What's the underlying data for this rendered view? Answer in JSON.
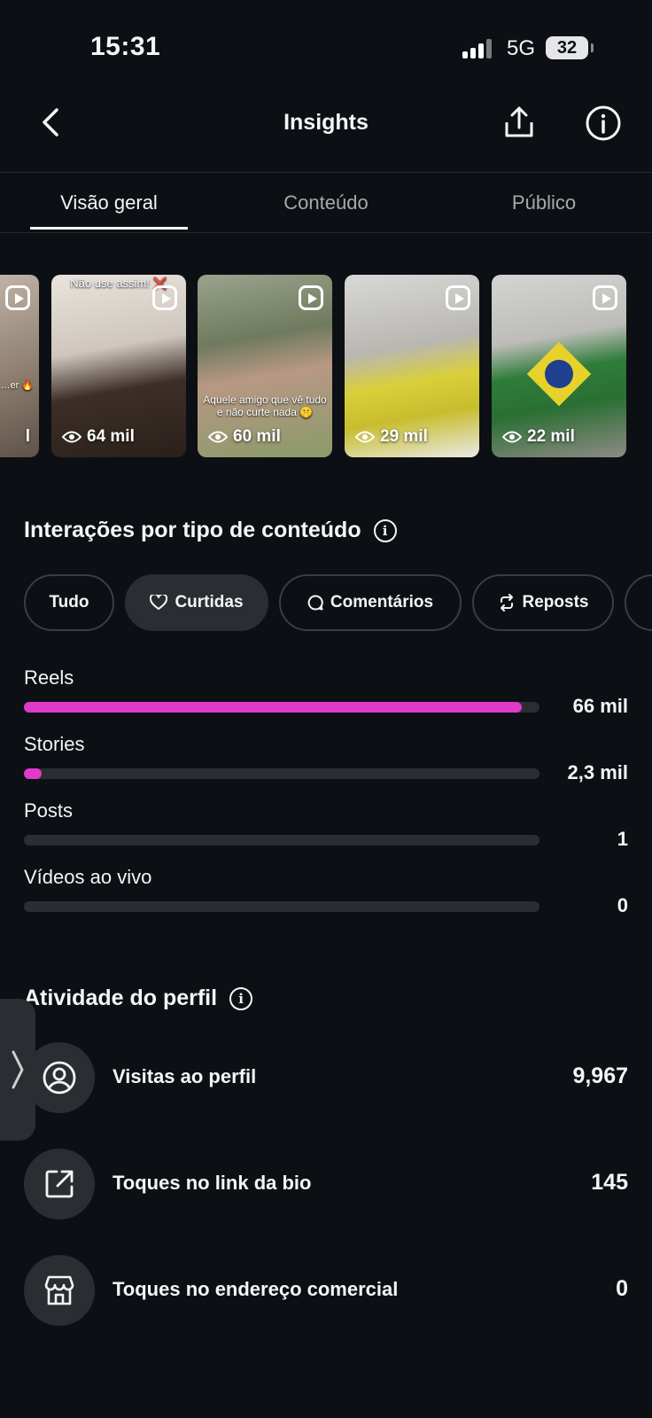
{
  "status": {
    "time": "15:31",
    "network": "5G",
    "battery": "32"
  },
  "header": {
    "title": "Insights"
  },
  "tabs": [
    {
      "label": "Visão geral",
      "active": true
    },
    {
      "label": "Conteúdo",
      "active": false
    },
    {
      "label": "Público",
      "active": false
    }
  ],
  "reels": [
    {
      "views": "",
      "caption": "…car 🇧🇷 …er 🔥"
    },
    {
      "views": "64 mil",
      "caption": "Não use assim! ❌"
    },
    {
      "views": "60 mil",
      "caption": "Aquele amigo que vê tudo e não curte nada 🤫"
    },
    {
      "views": "29 mil",
      "caption": ""
    },
    {
      "views": "22 mil",
      "caption": ""
    }
  ],
  "interactions": {
    "title": "Interações por tipo de conteúdo",
    "filters": [
      {
        "label": "Tudo",
        "icon": "",
        "selected": false
      },
      {
        "label": "Curtidas",
        "icon": "heart-icon",
        "selected": true
      },
      {
        "label": "Comentários",
        "icon": "comment-icon",
        "selected": false
      },
      {
        "label": "Reposts",
        "icon": "repost-icon",
        "selected": false
      }
    ],
    "bars": [
      {
        "label": "Reels",
        "value": "66 mil",
        "fraction": 0.966
      },
      {
        "label": "Stories",
        "value": "2,3 mil",
        "fraction": 0.034
      },
      {
        "label": "Posts",
        "value": "1",
        "fraction": 0
      },
      {
        "label": "Vídeos ao vivo",
        "value": "0",
        "fraction": 0
      }
    ],
    "accent_color": "#e03acb"
  },
  "activity": {
    "title": "Atividade do perfil",
    "items": [
      {
        "label": "Visitas ao perfil",
        "value": "9,967",
        "icon": "profile-icon"
      },
      {
        "label": "Toques no link da bio",
        "value": "145",
        "icon": "external-link-icon"
      },
      {
        "label": "Toques no endereço comercial",
        "value": "0",
        "icon": "storefront-icon"
      }
    ]
  }
}
